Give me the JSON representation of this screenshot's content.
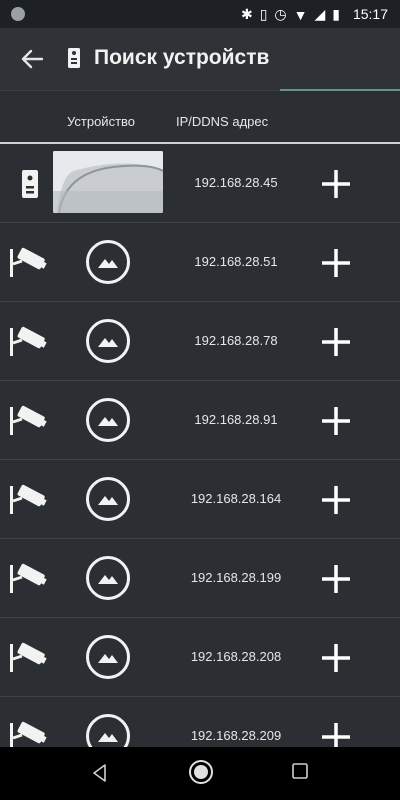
{
  "status_bar": {
    "time": "15:17",
    "icons": [
      "bluetooth-icon",
      "vibrate-icon",
      "alarm-icon",
      "wifi-icon",
      "signal-icon",
      "battery-icon"
    ]
  },
  "app_bar": {
    "title": "Поиск устройств"
  },
  "table": {
    "headers": {
      "device": "Устройство",
      "ip": "IP/DDNS адрес"
    },
    "rows": [
      {
        "type": "doorbell",
        "ip": "192.168.28.45"
      },
      {
        "type": "camera",
        "ip": "192.168.28.51"
      },
      {
        "type": "camera",
        "ip": "192.168.28.78"
      },
      {
        "type": "camera",
        "ip": "192.168.28.91"
      },
      {
        "type": "camera",
        "ip": "192.168.28.164"
      },
      {
        "type": "camera",
        "ip": "192.168.28.199"
      },
      {
        "type": "camera",
        "ip": "192.168.28.208"
      },
      {
        "type": "camera",
        "ip": "192.168.28.209"
      }
    ]
  },
  "colors": {
    "background": "#2b2e33",
    "status_bar": "#1d2024",
    "accent_underline": "#6b8f8f"
  }
}
